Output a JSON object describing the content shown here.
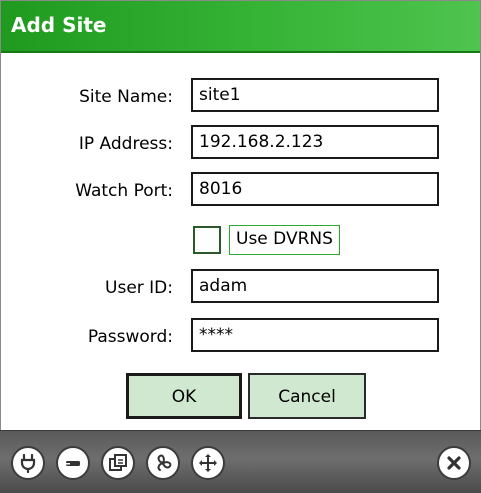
{
  "dialog": {
    "title": "Add Site"
  },
  "fields": {
    "site_name": {
      "label": "Site Name:",
      "value": "site1"
    },
    "ip_address": {
      "label": "IP Address:",
      "value": "192.168.2.123"
    },
    "watch_port": {
      "label": "Watch Port:",
      "value": "8016"
    },
    "user_id": {
      "label": "User ID:",
      "value": "adam"
    },
    "password": {
      "label": "Password:",
      "value": "****"
    }
  },
  "use_dvrns": {
    "label": "Use DVRNS",
    "checked": false
  },
  "buttons": {
    "ok_label": "OK",
    "cancel_label": "Cancel"
  },
  "toolbar": {
    "icons": [
      "power-plug-icon",
      "minus-icon",
      "windows-icon",
      "fan-icon",
      "move-arrows-icon",
      "close-icon"
    ]
  },
  "colors": {
    "title_bar": "#36b436",
    "button_fill": "#cfe8cf",
    "toolbar": "#5a5a5a"
  }
}
